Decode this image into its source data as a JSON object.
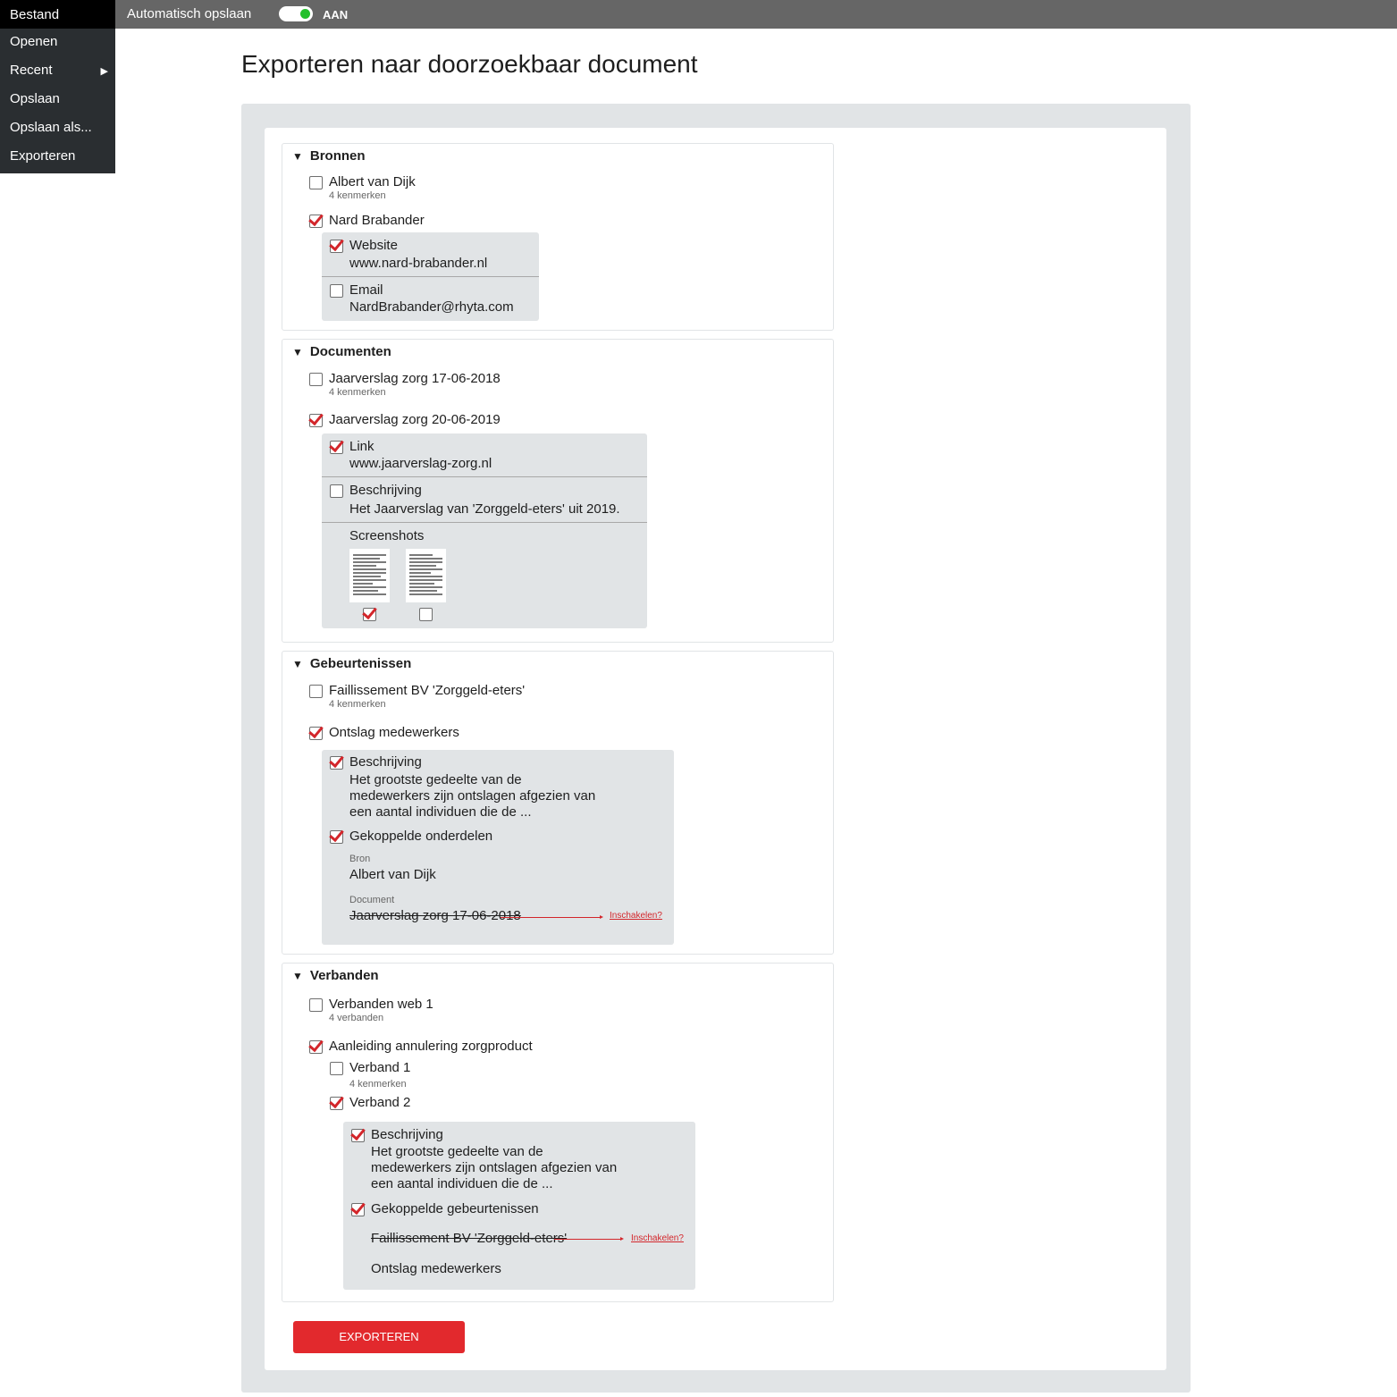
{
  "topbar": {
    "autosave_label": "Automatisch opslaan",
    "toggle_state": "AAN"
  },
  "menu": {
    "title": "Bestand",
    "items": [
      {
        "label": "Openen"
      },
      {
        "label": "Recent",
        "arrow": "▶"
      },
      {
        "label": "Opslaan"
      },
      {
        "label": "Opslaan als..."
      },
      {
        "label": "Exporteren"
      }
    ]
  },
  "page": {
    "title": "Exporteren naar doorzoekbaar document"
  },
  "bronnen": {
    "title": "Bronnen",
    "item1": {
      "label": "Albert van Dijk",
      "sub": "4 kenmerken",
      "checked": false
    },
    "item2": {
      "label": "Nard Brabander",
      "checked": true
    },
    "website": {
      "label": "Website",
      "value": "www.nard-brabander.nl",
      "checked": true
    },
    "email": {
      "label": "Email",
      "value": "NardBrabander@rhyta.com",
      "checked": false
    }
  },
  "documenten": {
    "title": "Documenten",
    "item1": {
      "label": "Jaarverslag zorg 17-06-2018",
      "sub": "4 kenmerken",
      "checked": false
    },
    "item2": {
      "label": "Jaarverslag zorg 20-06-2019",
      "checked": true
    },
    "link": {
      "label": "Link",
      "value": "www.jaarverslag-zorg.nl",
      "checked": true
    },
    "beschrijving": {
      "label": "Beschrijving",
      "value": "Het Jaarverslag van 'Zorggeld-eters' uit 2019.",
      "checked": false
    },
    "screenshots": {
      "label": "Screenshots",
      "shot1_checked": true,
      "shot2_checked": false
    }
  },
  "gebeurtenissen": {
    "title": "Gebeurtenissen",
    "item1": {
      "label": "Faillissement BV 'Zorggeld-eters'",
      "sub": "4 kenmerken",
      "checked": false
    },
    "item2": {
      "label": "Ontslag medewerkers",
      "checked": true
    },
    "beschrijving": {
      "label": "Beschrijving",
      "lines": [
        "Het grootste gedeelte van de",
        "medewerkers zijn ontslagen afgezien van",
        "een aantal individuen die de ..."
      ],
      "checked": true
    },
    "gekoppeld": {
      "label": "Gekoppelde onderdelen",
      "checked": true,
      "bron_label": "Bron",
      "bron_value": "Albert van Dijk",
      "document_label": "Document",
      "document_value": "Jaarverslag zorg 17-06-2018",
      "enable_link": "Inschakelen?"
    }
  },
  "verbanden": {
    "title": "Verbanden",
    "item1": {
      "label": "Verbanden web 1",
      "sub": "4 verbanden",
      "checked": false
    },
    "item2": {
      "label": "Aanleiding annulering zorgproduct",
      "checked": true
    },
    "verband1": {
      "label": "Verband 1",
      "sub": "4 kenmerken",
      "checked": false
    },
    "verband2": {
      "label": "Verband 2",
      "checked": true
    },
    "beschrijving": {
      "label": "Beschrijving",
      "lines": [
        "Het grootste gedeelte van de",
        "medewerkers zijn ontslagen afgezien van",
        "een aantal individuen die de ..."
      ],
      "checked": true
    },
    "gekoppeld": {
      "label": "Gekoppelde gebeurtenissen",
      "checked": true,
      "event1": "Faillissement BV 'Zorggeld-eters'",
      "enable_link": "Inschakelen?",
      "event2": "Ontslag medewerkers"
    }
  },
  "export_button": {
    "label": "EXPORTEREN"
  },
  "colors": {
    "accent": "#e2292d",
    "check": "#d3262b",
    "toggle_on": "#22c02b",
    "topbar": "#666666",
    "menu_bg": "#2a2e31",
    "panel_grey": "#e1e4e6"
  }
}
